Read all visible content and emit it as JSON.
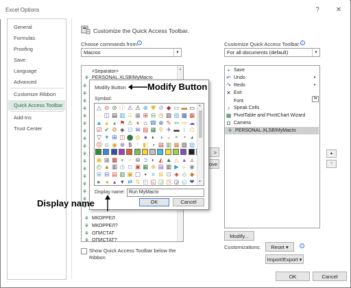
{
  "window": {
    "title": "Excel Options",
    "help_label": "?",
    "close_label": "✕"
  },
  "sidebar": {
    "items": [
      "General",
      "Formulas",
      "Proofing",
      "Save",
      "Language",
      "Advanced",
      "Customize Ribbon",
      "Quick Access Toolbar",
      "Add-Ins",
      "Trust Center"
    ],
    "active": "Quick Access Toolbar"
  },
  "main": {
    "heading": "Customize the Quick Access Toolbar.",
    "choose_label": "Choose commands from:",
    "choose_value": "Macros",
    "customize_label": "Customize Quick Access Toolbar:",
    "customize_value": "For all documents (default)",
    "left_list": [
      {
        "label": "<Separator>",
        "icon": "none"
      },
      {
        "label": "PERSONAL.XLSB!MyMacro",
        "icon": "macro-icon"
      }
    ],
    "left_list_bottom": [
      {
        "label": "МКОРРЕЛ",
        "icon": "macro-icon"
      },
      {
        "label": "МКОРРЕЛ?",
        "icon": "macro-icon"
      },
      {
        "label": "ОПИСТАТ",
        "icon": "macro-icon"
      },
      {
        "label": "ОПИСТАТ?",
        "icon": "macro-icon"
      }
    ],
    "right_list": [
      {
        "label": "Save",
        "icon": "save-icon",
        "symbol": "▪",
        "color": "#3a5aa8"
      },
      {
        "label": "Undo",
        "icon": "undo-icon",
        "symbol": "↶",
        "color": "#3a5aa8",
        "expander": "▸"
      },
      {
        "label": "Redo",
        "icon": "redo-icon",
        "symbol": "↷",
        "color": "#3a5aa8",
        "expander": "▸"
      },
      {
        "label": "Exit",
        "icon": "exit-icon",
        "symbol": "✕",
        "color": "#333333"
      },
      {
        "label": "Font",
        "icon": "font-icon",
        "symbol": "",
        "color": "#333333",
        "expander": "I▾"
      },
      {
        "label": "Speak Cells",
        "icon": "speak-cells-icon",
        "symbol": "♪",
        "color": "#2f7a43"
      },
      {
        "label": "PivotTable and PivotChart Wizard",
        "icon": "pivot-icon",
        "symbol": "▦",
        "color": "#2f7a43"
      },
      {
        "label": "Camera",
        "icon": "camera-icon",
        "symbol": "◘",
        "color": "#444444"
      },
      {
        "label": "PERSONAL.XLSB!MyMacro",
        "icon": "macro-icon",
        "symbol": "",
        "color": "#2f7a43"
      }
    ],
    "add_button_fragment": ">",
    "remove_button_fragment": "ove",
    "modify_button": "Modify...",
    "customizations_label": "Customizations:",
    "reset_button": "Reset ▾",
    "import_export_button": "Import/Export ▾",
    "show_below_label_line1": "Show Quick Access Toolbar below the",
    "show_below_label_line2": "Ribbon",
    "ok_button": "OK",
    "cancel_button": "Cancel"
  },
  "modify_dialog": {
    "title": "Modify Button",
    "symbol_label": "Symbol:",
    "display_name_label": "Display name:",
    "display_name_value": "Run MyMacro",
    "ok_button": "OK",
    "cancel_button": "Cancel",
    "symbols": [
      [
        "△",
        "⊘",
        "⊘",
        "ⓘ",
        "⚠",
        "⚠",
        "⊕",
        "⛊",
        "⊘",
        "◆",
        "▭",
        "▬",
        "▭",
        "▭"
      ],
      [
        "◌",
        "◫",
        "▤",
        "▥",
        "⌸",
        "▦",
        "⊞",
        "⊟",
        "◷",
        "▧",
        "▨",
        "▩",
        "▦",
        "▣"
      ],
      [
        "▲",
        "▲",
        "▴",
        "⚑",
        "⚠",
        "♦",
        "⌂",
        "☎",
        "⊕",
        "✎",
        "⇦",
        "⇨",
        "☁"
      ],
      [
        "☑",
        "✔",
        "⚙",
        "◈",
        "⊡",
        "✉",
        "▧",
        "▦",
        "⚲",
        "✈",
        "▬",
        "↕",
        "⌬",
        "↻"
      ],
      [
        "▽",
        "▼",
        "⊞",
        "◫",
        "⬤",
        "◎",
        "●",
        "◐",
        "◑",
        "◒",
        "◓",
        "◔",
        "◕",
        "◆"
      ],
      [
        "☹",
        "☺",
        "◉",
        "⊗",
        "$",
        "⁻",
        "◧",
        "◑",
        "▤",
        "▥",
        "▦",
        "▧",
        "▨",
        "▩"
      ],
      [
        "■",
        "■",
        "■",
        "■",
        "■",
        "■",
        "■",
        "■",
        "■",
        "■",
        "■",
        "■",
        "■",
        "■"
      ],
      [
        "▣",
        "▦",
        "▩",
        "▪",
        "▫",
        "⊖",
        "➲",
        "◐",
        "◭",
        "▲",
        "△",
        "▴",
        "▵",
        "▤"
      ],
      [
        "◴",
        "▲",
        "▥",
        "◷",
        "□",
        "▣",
        "▦",
        "⊕",
        "▤",
        "▥",
        "▶",
        "▹",
        "◉",
        "◢"
      ],
      [
        "⊞",
        "⊟",
        "▤",
        "▥",
        "▣",
        "▢",
        "▪",
        "⌗",
        "⊠",
        "⊡",
        "◈",
        "◇",
        "◆",
        "◊"
      ],
      [
        "▸",
        "◂",
        "▴",
        "▾",
        "⇄",
        "⇅",
        "◰",
        "◱",
        "◲",
        "◳",
        "◶",
        "◵",
        "❤",
        "◆"
      ]
    ],
    "symbol_colors": [
      "#3a5aa8",
      "#d04a2a",
      "#2f7a43",
      "#d9a52a",
      "#7a4ab0",
      "#333333",
      "#2aa0c8",
      "#e0c040",
      "#888888",
      "#b03030",
      "#5a8a3a",
      "#c87a2a",
      "#3a3a3a",
      "#6aa0d8"
    ],
    "swatch_colors": [
      "#2f8a3a",
      "#3a8ad8",
      "#3050b0",
      "#a040b0",
      "#e06030",
      "#7ac050",
      "#ffd030",
      "#c0c0c0",
      "#40c0e0",
      "#f0e040",
      "#a0d050",
      "#8050c0",
      "#202020",
      "#e0e0e0"
    ]
  },
  "annotations": {
    "modify_button": "Modify Button",
    "display_name": "Display name"
  }
}
